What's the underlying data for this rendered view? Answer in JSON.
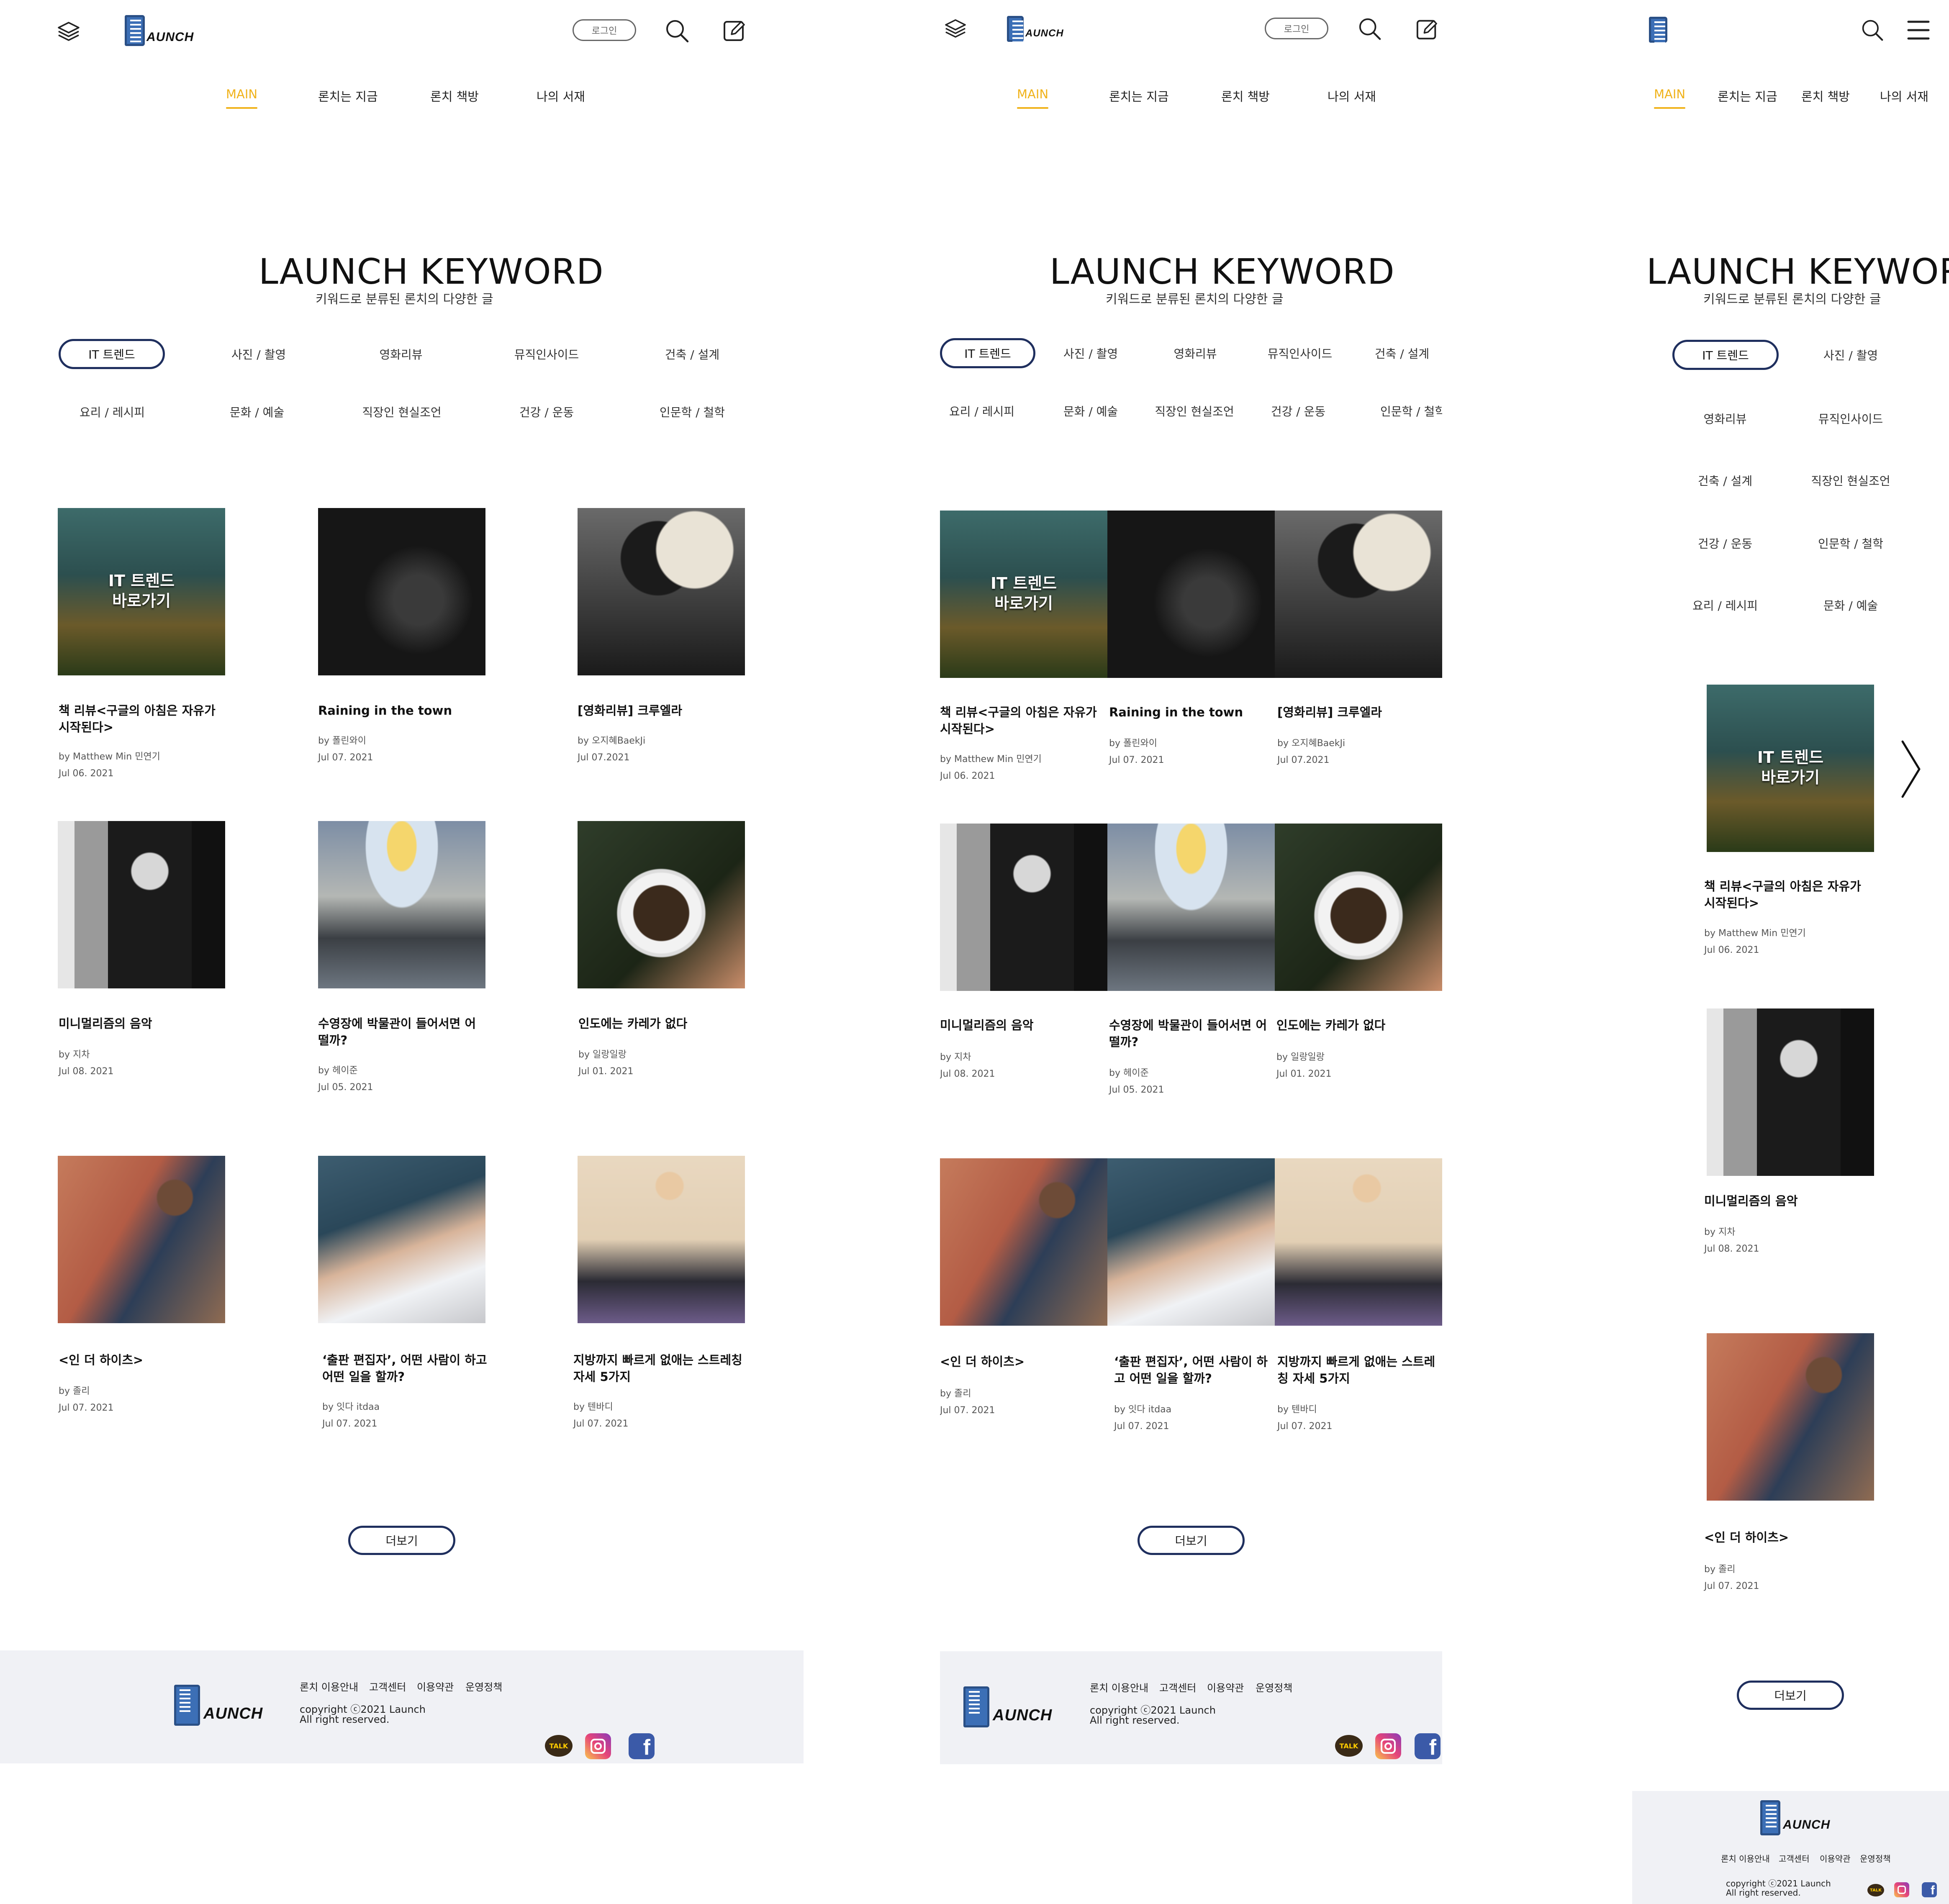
{
  "header": {
    "logo_text": "AUNCH",
    "login_label": "로그인"
  },
  "nav": [
    "MAIN",
    "론치는 지금",
    "론치 책방",
    "나의 서재"
  ],
  "hero": {
    "title": "LAUNCH KEYWORD",
    "subtitle": "키워드로 분류된 론치의 다양한 글"
  },
  "categories": [
    "IT 트렌드",
    "사진 / 촬영",
    "영화리뷰",
    "뮤직인사이드",
    "건축 / 설계",
    "요리 / 레시피",
    "문화 / 예술",
    "직장인 현실조언",
    "건강 / 운동",
    "인문학 / 철학"
  ],
  "mobile_categories": [
    "IT 트렌드",
    "사진 / 촬영",
    "영화리뷰",
    "뮤직인사이드",
    "건축 / 설계",
    "직장인 현실조언",
    "건강 / 운동",
    "인문학 / 철학",
    "요리 / 레시피",
    "문화 / 예술"
  ],
  "overlay": {
    "line1": "IT 트렌드",
    "line2": "바로가기"
  },
  "cards": [
    {
      "title": "책 리뷰<구글의 아침은 자유가 시작된다>",
      "author": "by Matthew Min 민연기",
      "date": "Jul 06. 2021",
      "image": "it-trend-image"
    },
    {
      "title": "Raining in the town",
      "author": "by 폴린와이",
      "date": "Jul 07. 2021",
      "image": "phone-camera-image"
    },
    {
      "title": "[영화리뷰] 크루엘라",
      "author": "by 오지혜BaekJi",
      "date": "Jul 07.2021",
      "image": "cruella-image"
    },
    {
      "title": "미니멀리즘의 음악",
      "author": "by 지차",
      "date": "Jul 08. 2021",
      "image": "minimal-music-image"
    },
    {
      "title": "수영장에 박물관이 들어서면 어떨까?",
      "author": "by 헤이준",
      "date": "Jul 05. 2021",
      "image": "pool-museum-image"
    },
    {
      "title": "인도에는 카레가 없다",
      "author": "by 일랑일랑",
      "date": "Jul 01. 2021",
      "image": "curry-image"
    },
    {
      "title": "<인 더 하이츠>",
      "author": "by 졸리",
      "date": "Jul 07. 2021",
      "image": "in-the-heights-image"
    },
    {
      "title": "‘출판 편집자’, 어떤 사람이 하고 어떤 일을 할까?",
      "author": "by 잇다 itdaa",
      "date": "Jul 07. 2021",
      "image": "pen-writing-image"
    },
    {
      "title": "지방까지 빠르게 없애는 스트레칭 자세 5가지",
      "author": "by 텐바디",
      "date": "Jul 07. 2021",
      "image": "yoga-image"
    }
  ],
  "more_label": "더보기",
  "footer": {
    "links": [
      "론치 이용안내",
      "고객센터",
      "이용약관",
      "운영정책"
    ],
    "copyright_line1": "copyright ⓒ2021 Launch",
    "copyright_line2": "All right reserved.",
    "kakao_label": "TALK"
  },
  "colors": {
    "accent": "#f0b21a",
    "navy": "#1f2f5e",
    "footer_bg": "#f0f1f5",
    "brand_blue": "#3c6fb6"
  }
}
